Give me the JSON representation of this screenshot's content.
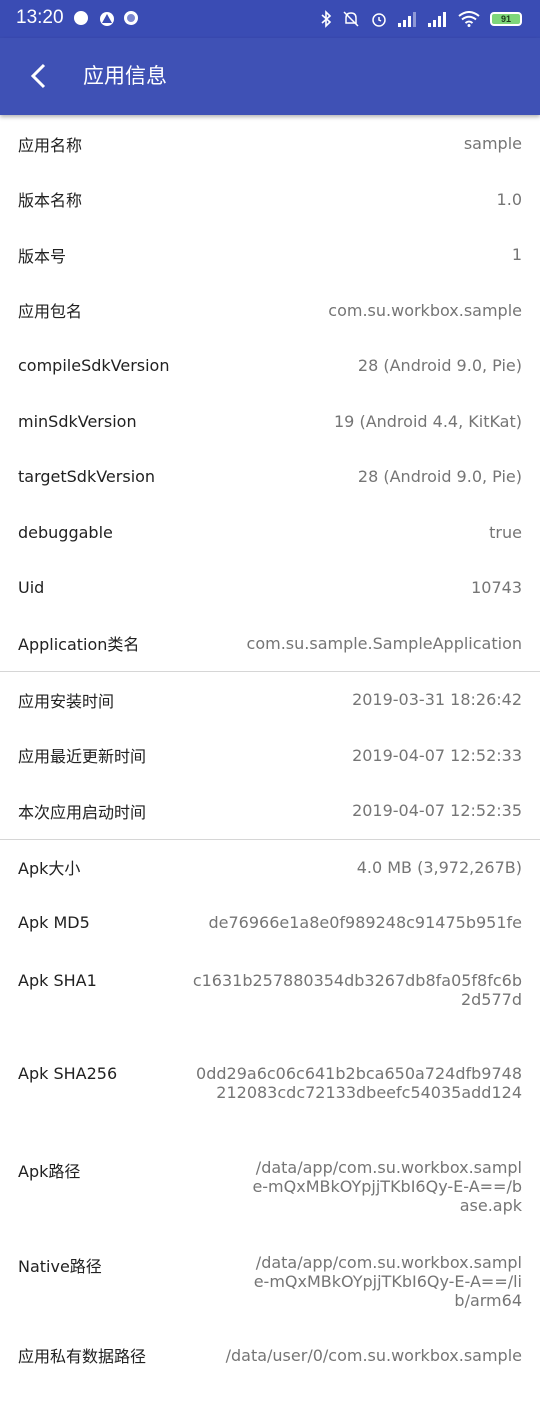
{
  "status_bar": {
    "time": "13:20",
    "battery": "91"
  },
  "app_bar": {
    "title": "应用信息"
  },
  "basic_section": [
    {
      "label": "应用名称",
      "value": "sample"
    },
    {
      "label": "版本名称",
      "value": "1.0"
    },
    {
      "label": "版本号",
      "value": "1"
    },
    {
      "label": "应用包名",
      "value": "com.su.workbox.sample"
    },
    {
      "label": "compileSdkVersion",
      "value": "28 (Android 9.0, Pie)"
    },
    {
      "label": "minSdkVersion",
      "value": "19 (Android 4.4, KitKat)"
    },
    {
      "label": "targetSdkVersion",
      "value": "28 (Android 9.0, Pie)"
    },
    {
      "label": "debuggable",
      "value": "true"
    },
    {
      "label": "Uid",
      "value": "10743"
    },
    {
      "label": "Application类名",
      "value": "com.su.sample.SampleApplication"
    }
  ],
  "time_section": [
    {
      "label": "应用安装时间",
      "value": "2019-03-31 18:26:42"
    },
    {
      "label": "应用最近更新时间",
      "value": "2019-04-07 12:52:33"
    },
    {
      "label": "本次应用启动时间",
      "value": "2019-04-07 12:52:35"
    }
  ],
  "apk_section": [
    {
      "label": "Apk大小",
      "value": "4.0 MB (3,972,267B)"
    },
    {
      "label": "Apk MD5",
      "value": "de76966e1a8e0f989248c91475b951fe"
    },
    {
      "label": "Apk SHA1",
      "value": "c1631b257880354db3267db8fa05f8fc6b2d577d"
    },
    {
      "label": "Apk SHA256",
      "value": "0dd29a6c06c641b2bca650a724dfb9748212083cdc72133dbeefc54035add124"
    },
    {
      "label": "Apk路径",
      "value": "/data/app/com.su.workbox.sample-mQxMBkOYpjjTKbI6Qy-E-A==/base.apk"
    },
    {
      "label": "Native路径",
      "value": "/data/app/com.su.workbox.sample-mQxMBkOYpjjTKbI6Qy-E-A==/lib/arm64"
    },
    {
      "label": "应用私有数据路径",
      "value": "/data/user/0/com.su.workbox.sample"
    }
  ]
}
